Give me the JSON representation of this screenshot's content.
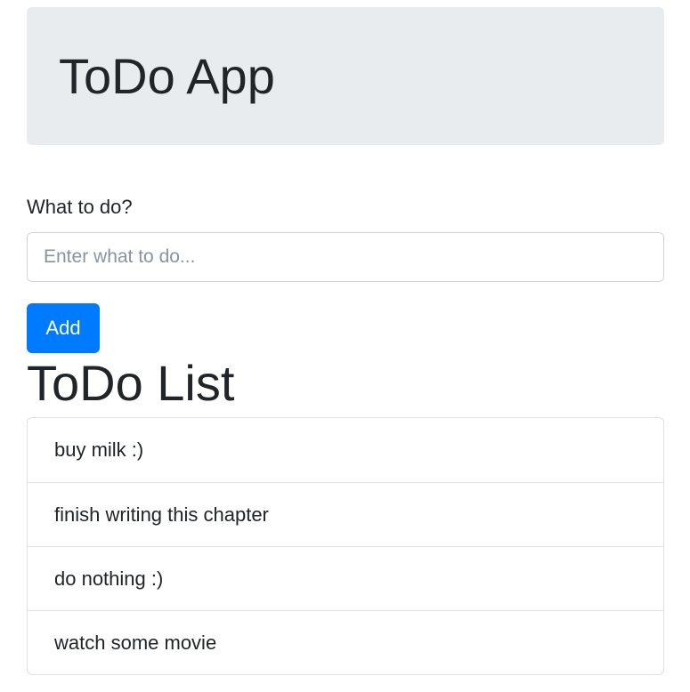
{
  "header": {
    "title": "ToDo App"
  },
  "form": {
    "label": "What to do?",
    "placeholder": "Enter what to do...",
    "value": "",
    "add_label": "Add",
    "accent_color": "#007bff"
  },
  "list": {
    "title": "ToDo List",
    "items": [
      {
        "text": "buy milk :)"
      },
      {
        "text": "finish writing this chapter"
      },
      {
        "text": "do nothing :)"
      },
      {
        "text": "watch some movie"
      }
    ]
  }
}
